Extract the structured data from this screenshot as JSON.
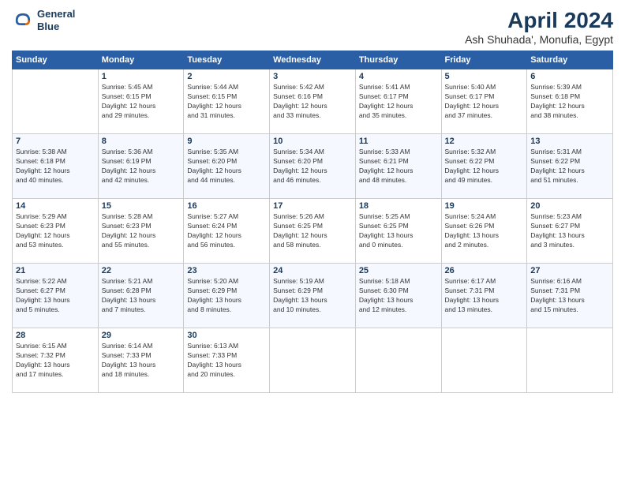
{
  "header": {
    "logo_line1": "General",
    "logo_line2": "Blue",
    "month": "April 2024",
    "location": "Ash Shuhada', Monufia, Egypt"
  },
  "weekdays": [
    "Sunday",
    "Monday",
    "Tuesday",
    "Wednesday",
    "Thursday",
    "Friday",
    "Saturday"
  ],
  "weeks": [
    [
      {
        "num": "",
        "info": ""
      },
      {
        "num": "1",
        "info": "Sunrise: 5:45 AM\nSunset: 6:15 PM\nDaylight: 12 hours\nand 29 minutes."
      },
      {
        "num": "2",
        "info": "Sunrise: 5:44 AM\nSunset: 6:15 PM\nDaylight: 12 hours\nand 31 minutes."
      },
      {
        "num": "3",
        "info": "Sunrise: 5:42 AM\nSunset: 6:16 PM\nDaylight: 12 hours\nand 33 minutes."
      },
      {
        "num": "4",
        "info": "Sunrise: 5:41 AM\nSunset: 6:17 PM\nDaylight: 12 hours\nand 35 minutes."
      },
      {
        "num": "5",
        "info": "Sunrise: 5:40 AM\nSunset: 6:17 PM\nDaylight: 12 hours\nand 37 minutes."
      },
      {
        "num": "6",
        "info": "Sunrise: 5:39 AM\nSunset: 6:18 PM\nDaylight: 12 hours\nand 38 minutes."
      }
    ],
    [
      {
        "num": "7",
        "info": "Sunrise: 5:38 AM\nSunset: 6:18 PM\nDaylight: 12 hours\nand 40 minutes."
      },
      {
        "num": "8",
        "info": "Sunrise: 5:36 AM\nSunset: 6:19 PM\nDaylight: 12 hours\nand 42 minutes."
      },
      {
        "num": "9",
        "info": "Sunrise: 5:35 AM\nSunset: 6:20 PM\nDaylight: 12 hours\nand 44 minutes."
      },
      {
        "num": "10",
        "info": "Sunrise: 5:34 AM\nSunset: 6:20 PM\nDaylight: 12 hours\nand 46 minutes."
      },
      {
        "num": "11",
        "info": "Sunrise: 5:33 AM\nSunset: 6:21 PM\nDaylight: 12 hours\nand 48 minutes."
      },
      {
        "num": "12",
        "info": "Sunrise: 5:32 AM\nSunset: 6:22 PM\nDaylight: 12 hours\nand 49 minutes."
      },
      {
        "num": "13",
        "info": "Sunrise: 5:31 AM\nSunset: 6:22 PM\nDaylight: 12 hours\nand 51 minutes."
      }
    ],
    [
      {
        "num": "14",
        "info": "Sunrise: 5:29 AM\nSunset: 6:23 PM\nDaylight: 12 hours\nand 53 minutes."
      },
      {
        "num": "15",
        "info": "Sunrise: 5:28 AM\nSunset: 6:23 PM\nDaylight: 12 hours\nand 55 minutes."
      },
      {
        "num": "16",
        "info": "Sunrise: 5:27 AM\nSunset: 6:24 PM\nDaylight: 12 hours\nand 56 minutes."
      },
      {
        "num": "17",
        "info": "Sunrise: 5:26 AM\nSunset: 6:25 PM\nDaylight: 12 hours\nand 58 minutes."
      },
      {
        "num": "18",
        "info": "Sunrise: 5:25 AM\nSunset: 6:25 PM\nDaylight: 13 hours\nand 0 minutes."
      },
      {
        "num": "19",
        "info": "Sunrise: 5:24 AM\nSunset: 6:26 PM\nDaylight: 13 hours\nand 2 minutes."
      },
      {
        "num": "20",
        "info": "Sunrise: 5:23 AM\nSunset: 6:27 PM\nDaylight: 13 hours\nand 3 minutes."
      }
    ],
    [
      {
        "num": "21",
        "info": "Sunrise: 5:22 AM\nSunset: 6:27 PM\nDaylight: 13 hours\nand 5 minutes."
      },
      {
        "num": "22",
        "info": "Sunrise: 5:21 AM\nSunset: 6:28 PM\nDaylight: 13 hours\nand 7 minutes."
      },
      {
        "num": "23",
        "info": "Sunrise: 5:20 AM\nSunset: 6:29 PM\nDaylight: 13 hours\nand 8 minutes."
      },
      {
        "num": "24",
        "info": "Sunrise: 5:19 AM\nSunset: 6:29 PM\nDaylight: 13 hours\nand 10 minutes."
      },
      {
        "num": "25",
        "info": "Sunrise: 5:18 AM\nSunset: 6:30 PM\nDaylight: 13 hours\nand 12 minutes."
      },
      {
        "num": "26",
        "info": "Sunrise: 6:17 AM\nSunset: 7:31 PM\nDaylight: 13 hours\nand 13 minutes."
      },
      {
        "num": "27",
        "info": "Sunrise: 6:16 AM\nSunset: 7:31 PM\nDaylight: 13 hours\nand 15 minutes."
      }
    ],
    [
      {
        "num": "28",
        "info": "Sunrise: 6:15 AM\nSunset: 7:32 PM\nDaylight: 13 hours\nand 17 minutes."
      },
      {
        "num": "29",
        "info": "Sunrise: 6:14 AM\nSunset: 7:33 PM\nDaylight: 13 hours\nand 18 minutes."
      },
      {
        "num": "30",
        "info": "Sunrise: 6:13 AM\nSunset: 7:33 PM\nDaylight: 13 hours\nand 20 minutes."
      },
      {
        "num": "",
        "info": ""
      },
      {
        "num": "",
        "info": ""
      },
      {
        "num": "",
        "info": ""
      },
      {
        "num": "",
        "info": ""
      }
    ]
  ]
}
